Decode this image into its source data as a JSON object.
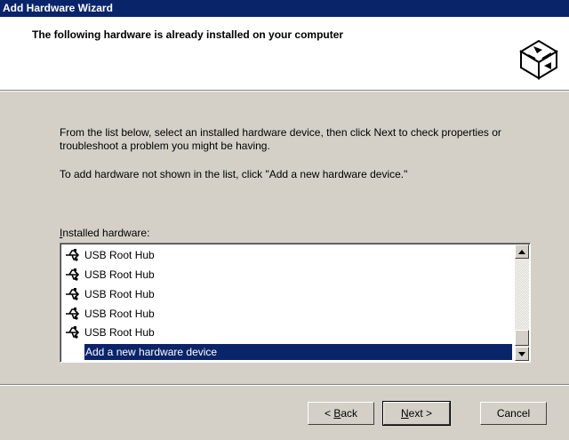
{
  "window": {
    "title": "Add Hardware Wizard"
  },
  "header": {
    "title": "The following hardware is already installed on your computer"
  },
  "body": {
    "instruction1": "From the list below, select an installed hardware device, then click Next to check properties or troubleshoot a problem you might be having.",
    "instruction2": "To add hardware not shown in the list, click \"Add a new hardware device.\""
  },
  "list": {
    "label_underlined": "I",
    "label_rest": "nstalled hardware:",
    "items": [
      "USB Root Hub",
      "USB Root Hub",
      "USB Root Hub",
      "USB Root Hub",
      "USB Root Hub"
    ],
    "selected_item": "Add a new hardware device",
    "item_icon": "usb-icon"
  },
  "buttons": {
    "back_prefix": "< ",
    "back_underlined": "B",
    "back_rest": "ack",
    "next_underlined": "N",
    "next_rest": "ext >",
    "cancel": "Cancel"
  },
  "colors": {
    "titlebar": "#0a246a",
    "selection": "#0a246a",
    "face": "#d4d0c8"
  }
}
